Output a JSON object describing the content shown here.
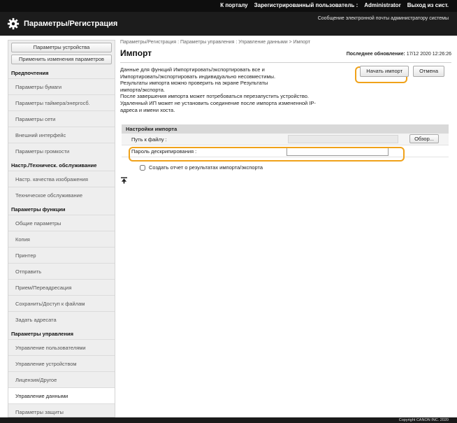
{
  "topbar": {
    "portal": "К порталу",
    "user_label": "Зарегистрированный пользователь :",
    "user": "Administrator",
    "logout": "Выход из сист."
  },
  "header": {
    "title": "Параметры/Регистрация",
    "message": "Сообщение электронной почты администратору системы"
  },
  "sidebar": {
    "buttons": [
      "Параметры устройства",
      "Применить изменения параметров"
    ],
    "groups": [
      {
        "heading": "Предпочтения",
        "items": [
          "Параметры бумаги",
          "Параметры таймера/энергосб.",
          "Параметры сети",
          "Внешний интерфейс",
          "Параметры громкости"
        ]
      },
      {
        "heading": "Настр./Техническ. обслуживание",
        "items": [
          "Настр. качества изображения",
          "Техническое обслуживание"
        ]
      },
      {
        "heading": "Параметры функции",
        "items": [
          "Общие параметры",
          "Копия",
          "Принтер",
          "Отправить",
          "Прием/Переадресация",
          "Сохранить/Доступ к файлам"
        ]
      },
      {
        "heading": "",
        "items": [
          "Задать адресата"
        ]
      },
      {
        "heading": "Параметры управления",
        "items": [
          "Управление пользователями",
          "Управление устройством",
          "Лицензия/Другое",
          "Управление данными",
          "Параметры защиты"
        ]
      }
    ],
    "active_item": "Управление данными"
  },
  "main": {
    "breadcrumb": "Параметры/Регистрация : Параметры управления : Управление данными > Импорт",
    "title": "Импорт",
    "last_updated_label": "Последнее обновление:",
    "last_updated": "17/12 2020 12:26:26",
    "description": [
      "Данные для функций Импортировать/экспортировать все и",
      "Импортировать/экспортировать индивидуально несовместимы.",
      "Результаты импорта можно проверить на экране Результаты",
      "импорта/экспорта.",
      "После завершения импорта может потребоваться перезапустить устройство.",
      "Удаленный ИП может не установить соединение после импорта измененной IP-",
      "адреса и имени хоста."
    ],
    "start_import": "Начать импорт",
    "cancel": "Отмена",
    "settings_heading": "Настройки импорта",
    "file_path_label": "Путь к файлу :",
    "browse": "Обзор...",
    "password_label": "Пароль дескрипирования :",
    "password_value": "",
    "report_label": "Создать отчет о результатах импорта/экспорта"
  },
  "footer": {
    "copyright": "Copyright CANON INC. 2020"
  },
  "colors": {
    "highlight": "#f0a21a",
    "header": "#1c1c1c"
  }
}
